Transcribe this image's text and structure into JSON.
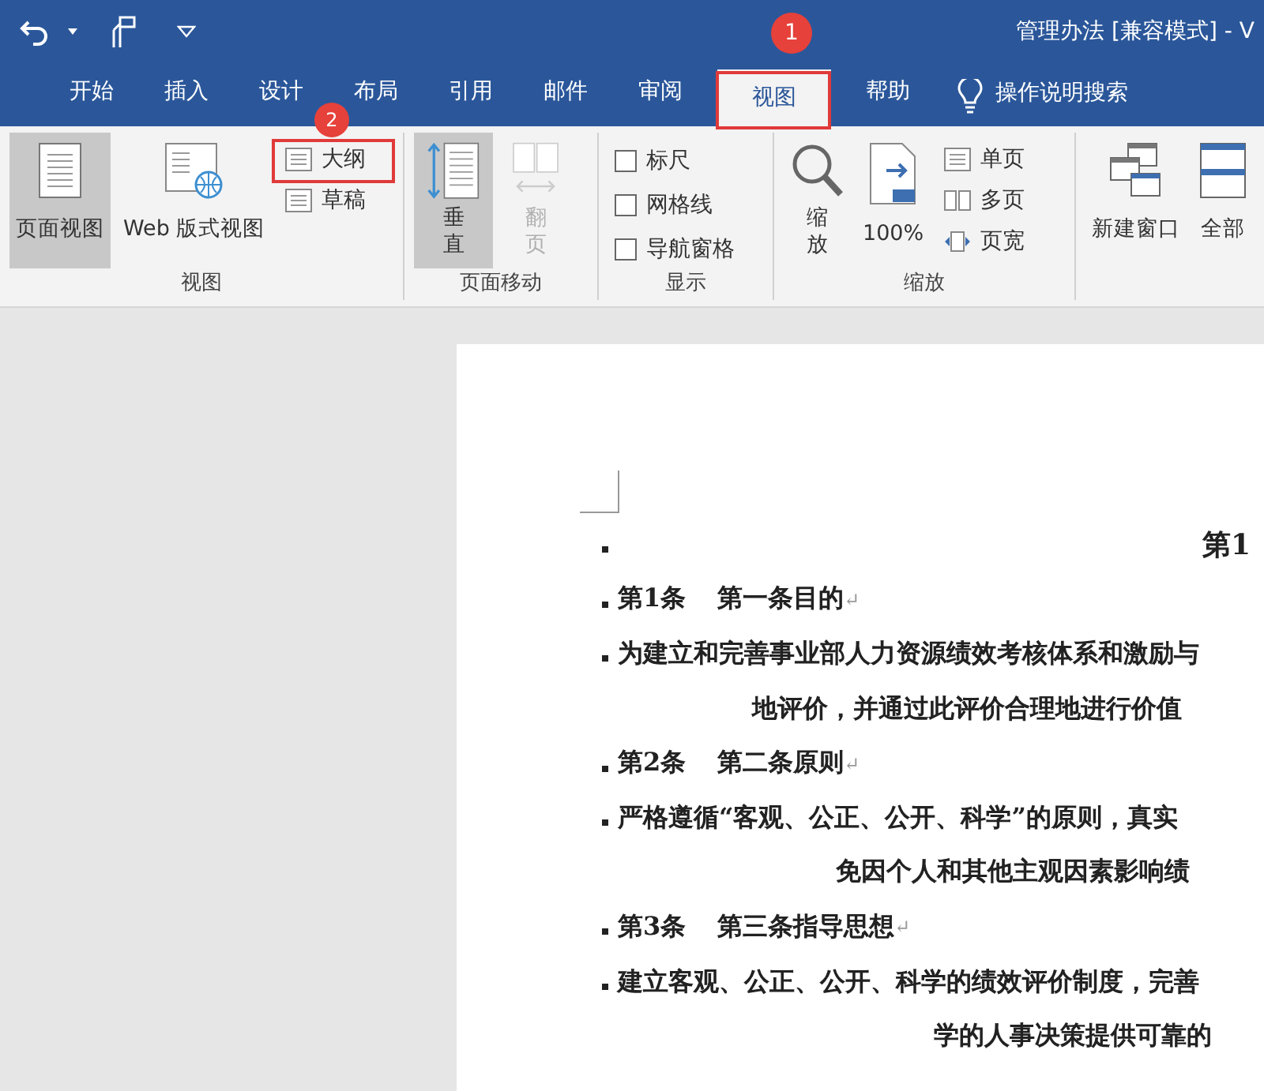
{
  "window": {
    "title": "管理办法 [兼容模式] - V"
  },
  "tabs": [
    {
      "label": "开始",
      "selected": false
    },
    {
      "label": "插入",
      "selected": false
    },
    {
      "label": "设计",
      "selected": false
    },
    {
      "label": "布局",
      "selected": false
    },
    {
      "label": "引用",
      "selected": false
    },
    {
      "label": "邮件",
      "selected": false
    },
    {
      "label": "审阅",
      "selected": false
    },
    {
      "label": "视图",
      "selected": true
    },
    {
      "label": "帮助",
      "selected": false
    }
  ],
  "tell_me": {
    "label": "操作说明搜索"
  },
  "ribbon": {
    "groups": [
      {
        "label": "视图",
        "items": [
          {
            "kind": "large",
            "label": "页面视图",
            "selected": true,
            "disabled": false
          },
          {
            "kind": "large",
            "label": "Web 版式视图",
            "selected": false,
            "disabled": false
          },
          {
            "kind": "small",
            "label": "大纲",
            "selected": false
          },
          {
            "kind": "small",
            "label": "草稿",
            "selected": false
          }
        ]
      },
      {
        "label": "页面移动",
        "items": [
          {
            "kind": "tall",
            "label": "垂直",
            "selected": true,
            "disabled": false
          },
          {
            "kind": "tall",
            "label": "翻页",
            "selected": false,
            "disabled": true
          }
        ]
      },
      {
        "label": "显示",
        "items": [
          {
            "kind": "check",
            "label": "标尺",
            "checked": false
          },
          {
            "kind": "check",
            "label": "网格线",
            "checked": false
          },
          {
            "kind": "check",
            "label": "导航窗格",
            "checked": false
          }
        ]
      },
      {
        "label": "缩放",
        "items": [
          {
            "kind": "tall",
            "label": "缩放",
            "selected": false,
            "disabled": false
          },
          {
            "kind": "large",
            "label": "100%",
            "selected": false,
            "disabled": false
          },
          {
            "kind": "small",
            "label": "单页",
            "selected": false
          },
          {
            "kind": "small",
            "label": "多页",
            "selected": false
          },
          {
            "kind": "small",
            "label": "页宽",
            "selected": false
          }
        ]
      },
      {
        "items": [
          {
            "kind": "large",
            "label": "新建窗口",
            "selected": false,
            "disabled": false
          },
          {
            "kind": "large",
            "label": "全部",
            "selected": false,
            "disabled": false
          }
        ]
      }
    ]
  },
  "annotations": [
    {
      "number": "1"
    },
    {
      "number": "2"
    }
  ],
  "document": {
    "paragraphs": [
      {
        "kind": "heading",
        "lines": [
          "第1"
        ]
      },
      {
        "kind": "article",
        "number": "第1条",
        "title": "第一条目的",
        "mark": "↵"
      },
      {
        "kind": "body",
        "lines": [
          "为建立和完善事业部人力资源绩效考核体系和激励与",
          "地评价，并通过此评价合理地进行价值"
        ]
      },
      {
        "kind": "article",
        "number": "第2条",
        "title": "第二条原则",
        "mark": "↵"
      },
      {
        "kind": "body",
        "lines": [
          "严格遵循“客观、公正、公开、科学”的原则，真实",
          "免因个人和其他主观因素影响绩"
        ]
      },
      {
        "kind": "article",
        "number": "第3条",
        "title": "第三条指导思想",
        "mark": "↵"
      },
      {
        "kind": "body",
        "lines": [
          "建立客观、公正、公开、科学的绩效评价制度，完善",
          "学的人事决策提供可靠的"
        ]
      }
    ]
  }
}
